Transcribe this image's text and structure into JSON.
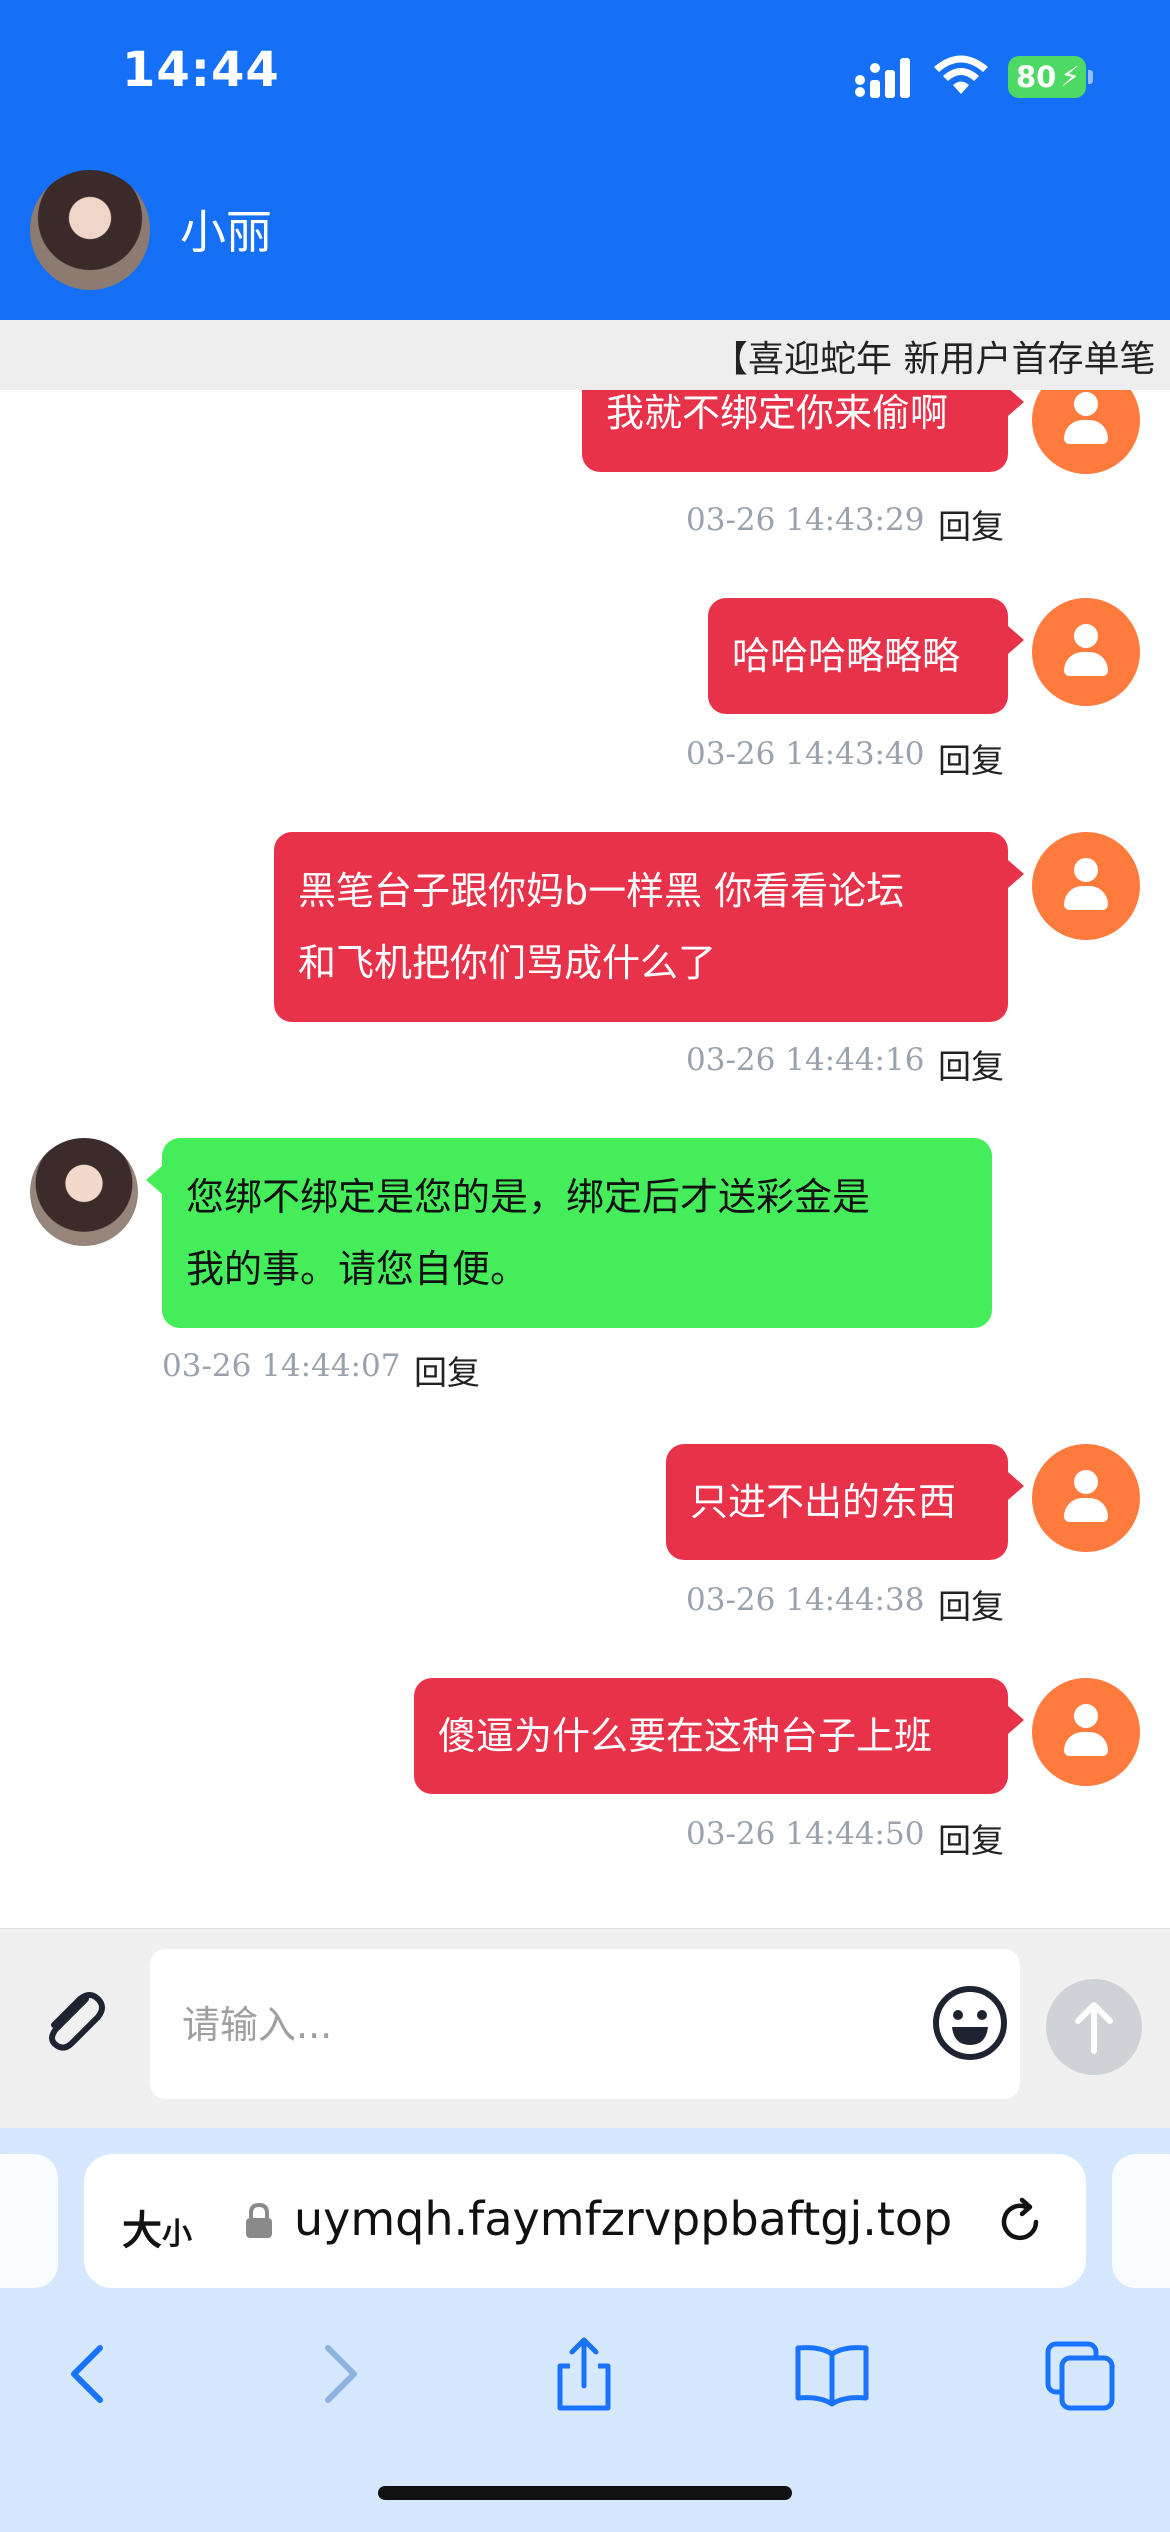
{
  "status_bar": {
    "time": "14:44",
    "battery": "80"
  },
  "header": {
    "contact_name": "小丽"
  },
  "marquee": {
    "text": "【喜迎蛇年 新用户首存单笔"
  },
  "messages": [
    {
      "side": "right",
      "text_lines": [
        "我就不绑定你来偷啊"
      ],
      "timestamp": "03-26 14:43:29",
      "reply": "回复"
    },
    {
      "side": "right",
      "text_lines": [
        "哈哈哈略略略"
      ],
      "timestamp": "03-26 14:43:40",
      "reply": "回复"
    },
    {
      "side": "right",
      "text_lines": [
        "黑笔台子跟你妈b一样黑 你看看论坛",
        "和飞机把你们骂成什么了"
      ],
      "timestamp": "03-26 14:44:16",
      "reply": "回复"
    },
    {
      "side": "left",
      "text_lines": [
        "您绑不绑定是您的是，绑定后才送彩金是",
        "我的事。请您自便。"
      ],
      "timestamp": "03-26 14:44:07",
      "reply": "回复"
    },
    {
      "side": "right",
      "text_lines": [
        "只进不出的东西"
      ],
      "timestamp": "03-26 14:44:38",
      "reply": "回复"
    },
    {
      "side": "right",
      "text_lines": [
        "傻逼为什么要在这种台子上班"
      ],
      "timestamp": "03-26 14:44:50",
      "reply": "回复"
    }
  ],
  "composer": {
    "placeholder": "请输入...",
    "value": ""
  },
  "browser": {
    "text_size_label": "大",
    "text_size_label_small": "小",
    "url": "uymqh.faymfzrvppbaftgj.top"
  },
  "colors": {
    "header_blue": "#1570f7",
    "outgoing_bubble": "#e8324a",
    "incoming_bubble": "#46ed5b",
    "user_avatar": "#ff7a3d"
  },
  "icons": [
    "signal-icon",
    "wifi-icon",
    "battery-icon",
    "user-avatar-icon",
    "paperclip-icon",
    "emoji-icon",
    "send-arrow-icon",
    "lock-icon",
    "reload-icon",
    "back-icon",
    "forward-icon",
    "share-icon",
    "bookmarks-icon",
    "tabs-icon"
  ]
}
